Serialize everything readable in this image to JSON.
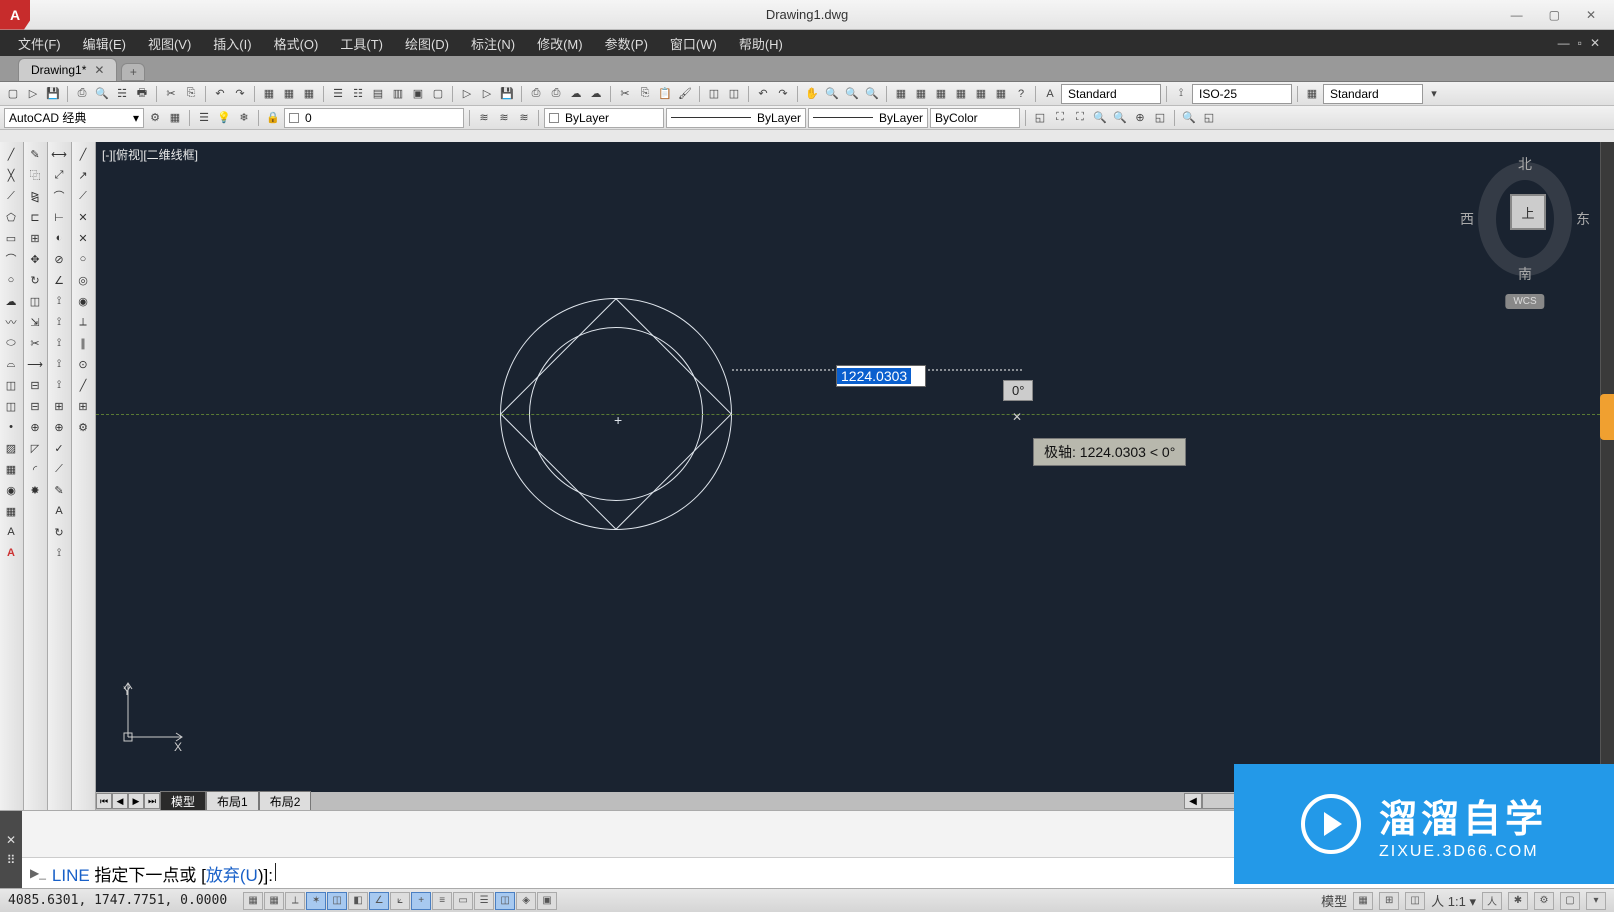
{
  "title": "Drawing1.dwg",
  "menus": [
    "文件(F)",
    "编辑(E)",
    "视图(V)",
    "插入(I)",
    "格式(O)",
    "工具(T)",
    "绘图(D)",
    "标注(N)",
    "修改(M)",
    "参数(P)",
    "窗口(W)",
    "帮助(H)"
  ],
  "doc_tab": "Drawing1*",
  "workspace": "AutoCAD 经典",
  "layer_current": "0",
  "prop_layer": "ByLayer",
  "prop_ltype": "ByLayer",
  "prop_lweight": "ByLayer",
  "prop_color": "ByColor",
  "text_style": "Standard",
  "dim_style": "ISO-25",
  "table_style": "Standard",
  "canvas": {
    "view_label": "[-][俯视][二维线框]",
    "viewcube": {
      "top": "上",
      "n": "北",
      "e": "东",
      "s": "南",
      "w": "西",
      "wcs": "WCS"
    },
    "dyn_length": "1224.0303",
    "dyn_angle": "0°",
    "polar_tip": "极轴: 1224.0303 < 0°",
    "ucs_y": "Y",
    "ucs_x": "X"
  },
  "layout_tabs": {
    "model": "模型",
    "l1": "布局1",
    "l2": "布局2"
  },
  "command": {
    "name": "LINE",
    "prompt_pre": " 指定下一点或 [",
    "opt_label": "放弃(",
    "opt_key": "U",
    "prompt_post": ")]:"
  },
  "status": {
    "coords": "4085.6301, 1747.7751, 0.0000",
    "scale": "1:1"
  },
  "watermark": {
    "big": "溜溜自学",
    "small": "ZIXUE.3D66.COM"
  }
}
